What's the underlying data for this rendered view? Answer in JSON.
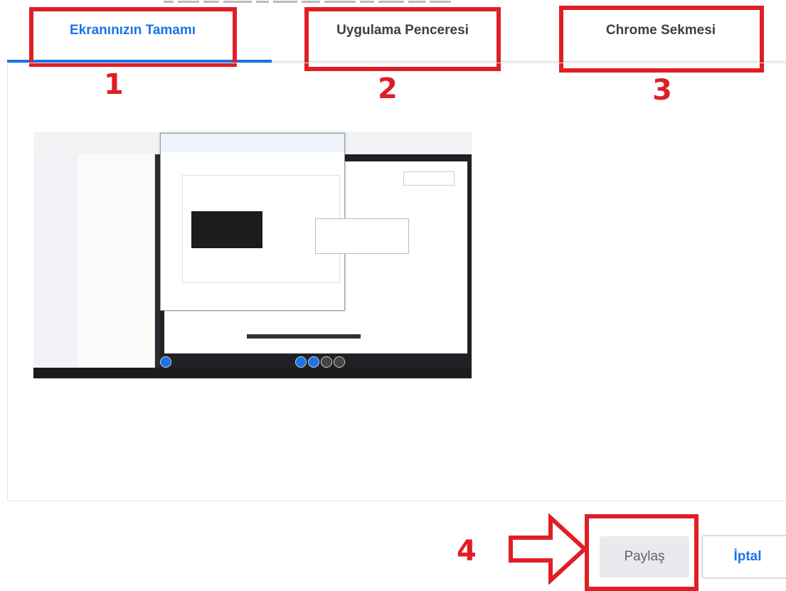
{
  "tabs": [
    {
      "label": "Ekranınızın Tamamı",
      "selected": true
    },
    {
      "label": "Uygulama Penceresi",
      "selected": false
    },
    {
      "label": "Chrome Sekmesi",
      "selected": false
    }
  ],
  "annotations": {
    "numbers": [
      "1",
      "2",
      "3",
      "4"
    ],
    "highlight_color": "#e01e25"
  },
  "preview": {
    "icon": "screen-preview-thumbnail"
  },
  "actions": {
    "share_label": "Paylaş",
    "cancel_label": "İptal"
  },
  "colors": {
    "accent": "#1a73e8",
    "annotation_red": "#e01e25"
  }
}
